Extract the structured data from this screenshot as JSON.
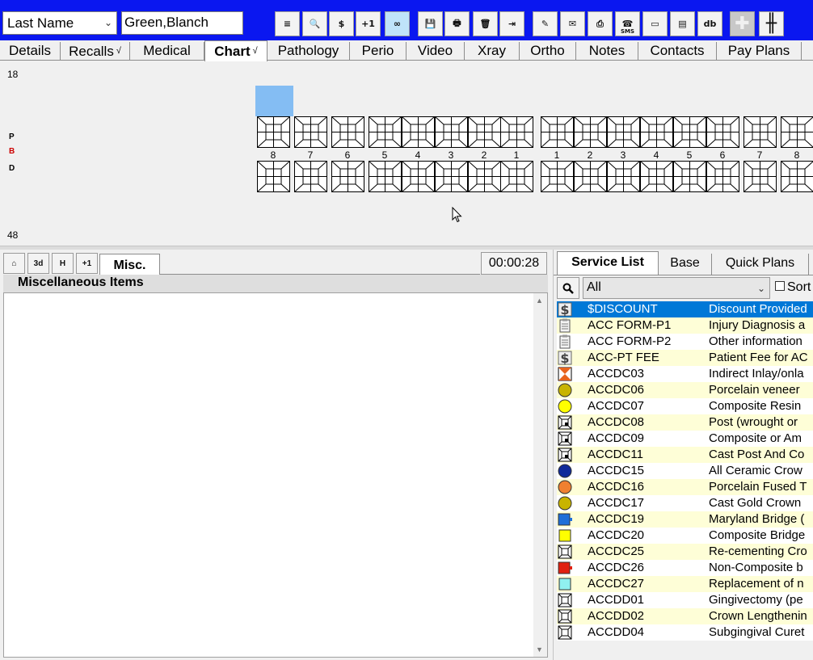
{
  "topbar": {
    "search_field": "Last Name",
    "patient_name": "Green,Blanch",
    "buttons": [
      {
        "name": "align-icon-button",
        "glyph": "≡"
      },
      {
        "name": "search-icon-button",
        "glyph": "🔍"
      },
      {
        "name": "dollar-icon-button",
        "glyph": "$"
      },
      {
        "name": "plus-one-button",
        "glyph": "+1"
      },
      {
        "name": "link-icon-button",
        "glyph": "∞"
      },
      {
        "name": "save-icon-button",
        "glyph": "💾"
      },
      {
        "name": "print-icon-button",
        "glyph": "🖶"
      },
      {
        "name": "trash-icon-button",
        "glyph": "🗑"
      },
      {
        "name": "merge-icon-button",
        "glyph": "⇥"
      },
      {
        "name": "pen-icon-button",
        "glyph": "✎"
      },
      {
        "name": "envelope-edit-icon-button",
        "glyph": "✉"
      },
      {
        "name": "printer-stack-icon-button",
        "glyph": "⎙"
      },
      {
        "name": "sms-icon-button",
        "glyph": "☎"
      },
      {
        "name": "card-icon-button",
        "glyph": "▭"
      },
      {
        "name": "sticky-note-icon-button",
        "glyph": "▤"
      },
      {
        "name": "db-button",
        "glyph": "db"
      },
      {
        "name": "add-disabled-button",
        "glyph": "✚"
      },
      {
        "name": "grid-button",
        "glyph": "╫"
      }
    ],
    "sms_label": "SMS"
  },
  "tabs": [
    {
      "label": "Details"
    },
    {
      "label": "Recalls",
      "tick": "√"
    },
    {
      "label": "Medical"
    },
    {
      "label": "Chart",
      "tick": "√"
    },
    {
      "label": "Pathology"
    },
    {
      "label": "Perio"
    },
    {
      "label": "Video"
    },
    {
      "label": "Xray"
    },
    {
      "label": "Ortho"
    },
    {
      "label": "Notes"
    },
    {
      "label": "Contacts"
    },
    {
      "label": "Pay Plans"
    }
  ],
  "chart": {
    "upper_quadrant": "18",
    "lower_quadrant": "48",
    "side_letters": [
      "P",
      "B",
      "D"
    ],
    "tooth_numbers": [
      "8",
      "7",
      "6",
      "5",
      "4",
      "3",
      "2",
      "1",
      "1",
      "2",
      "3",
      "4",
      "5",
      "6",
      "7",
      "8"
    ]
  },
  "misc_panel": {
    "mini_buttons": [
      "⌂",
      "3d",
      "H",
      "+1"
    ],
    "tab_label": "Misc.",
    "timer": "00:00:28",
    "header": "Miscellaneous Items"
  },
  "service_panel": {
    "tabs": [
      "Service List",
      "Base",
      "Quick Plans"
    ],
    "filter": "All",
    "sort_label": "Sort",
    "rows": [
      {
        "code": "$DISCOUNT",
        "desc": "Discount Provided",
        "icon": "dollar",
        "color": "#0078d7"
      },
      {
        "code": "ACC FORM-P1",
        "desc": "Injury Diagnosis a",
        "icon": "clipboard",
        "color": "#888888"
      },
      {
        "code": "ACC FORM-P2",
        "desc": "Other information",
        "icon": "clipboard",
        "color": "#888888"
      },
      {
        "code": "ACC-PT FEE",
        "desc": "Patient Fee for AC",
        "icon": "dollar",
        "color": "#555555"
      },
      {
        "code": "ACCDC03",
        "desc": "Indirect Inlay/onla",
        "icon": "inlay",
        "color": "#e8641e"
      },
      {
        "code": "ACCDC06",
        "desc": "Porcelain veneer",
        "icon": "circle",
        "color": "#c8b400"
      },
      {
        "code": "ACCDC07",
        "desc": "Composite Resin",
        "icon": "circle",
        "color": "#ffff00"
      },
      {
        "code": "ACCDC08",
        "desc": "Post (wrought or",
        "icon": "tooth-post",
        "color": "#000000"
      },
      {
        "code": "ACCDC09",
        "desc": "Composite or Am",
        "icon": "tooth-post",
        "color": "#000000"
      },
      {
        "code": "ACCDC11",
        "desc": "Cast Post And Co",
        "icon": "tooth-post",
        "color": "#000000"
      },
      {
        "code": "ACCDC15",
        "desc": "All Ceramic Crow",
        "icon": "circle",
        "color": "#102a9a"
      },
      {
        "code": "ACCDC16",
        "desc": "Porcelain Fused T",
        "icon": "circle",
        "color": "#f08030"
      },
      {
        "code": "ACCDC17",
        "desc": "Cast Gold Crown",
        "icon": "circle",
        "color": "#c8b400"
      },
      {
        "code": "ACCDC19",
        "desc": "Maryland Bridge (",
        "icon": "bridge",
        "color": "#1e6ed8"
      },
      {
        "code": "ACCDC20",
        "desc": "Composite Bridge",
        "icon": "square",
        "color": "#ffff00"
      },
      {
        "code": "ACCDC25",
        "desc": "Re-cementing Cro",
        "icon": "tooth",
        "color": "#000000"
      },
      {
        "code": "ACCDC26",
        "desc": "Non-Composite b",
        "icon": "bridge",
        "color": "#e02010"
      },
      {
        "code": "ACCDC27",
        "desc": "Replacement of n",
        "icon": "square",
        "color": "#90f0f0"
      },
      {
        "code": "ACCDD01",
        "desc": "Gingivectomy (pe",
        "icon": "tooth",
        "color": "#000000"
      },
      {
        "code": "ACCDD02",
        "desc": "Crown Lengthenin",
        "icon": "tooth",
        "color": "#000000"
      },
      {
        "code": "ACCDD04",
        "desc": "Subgingival Curet",
        "icon": "tooth",
        "color": "#000000"
      }
    ]
  }
}
